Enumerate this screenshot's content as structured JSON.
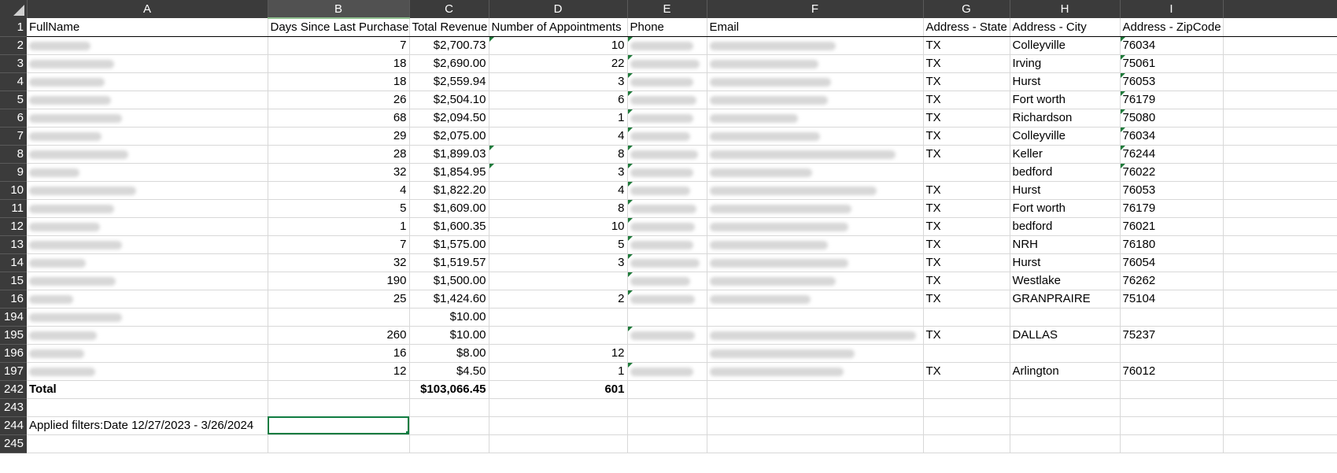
{
  "columns": [
    "A",
    "B",
    "C",
    "D",
    "E",
    "F",
    "G",
    "H",
    "I"
  ],
  "header": {
    "row": "1",
    "cells": [
      "FullName",
      "Days Since Last Purchase",
      "Total Revenue",
      "Number of Appointments",
      "Phone",
      "Email",
      "Address - State",
      "Address - City",
      "Address - ZipCode"
    ]
  },
  "rows": [
    {
      "row": "2",
      "days": "7",
      "revenue": "$2,700.73",
      "appts": "10",
      "state": "TX",
      "city": "Colleyville",
      "zip": "76034"
    },
    {
      "row": "3",
      "days": "18",
      "revenue": "$2,690.00",
      "appts": "22",
      "state": "TX",
      "city": "Irving",
      "zip": "75061"
    },
    {
      "row": "4",
      "days": "18",
      "revenue": "$2,559.94",
      "appts": "3",
      "state": "TX",
      "city": "Hurst",
      "zip": "76053"
    },
    {
      "row": "5",
      "days": "26",
      "revenue": "$2,504.10",
      "appts": "6",
      "state": "TX",
      "city": "Fort worth",
      "zip": "76179"
    },
    {
      "row": "6",
      "days": "68",
      "revenue": "$2,094.50",
      "appts": "1",
      "state": "TX",
      "city": "Richardson",
      "zip": "75080"
    },
    {
      "row": "7",
      "days": "29",
      "revenue": "$2,075.00",
      "appts": "4",
      "state": "TX",
      "city": "Colleyville",
      "zip": "76034"
    },
    {
      "row": "8",
      "days": "28",
      "revenue": "$1,899.03",
      "appts": "8",
      "state": "TX",
      "city": "Keller",
      "zip": "76244"
    },
    {
      "row": "9",
      "days": "32",
      "revenue": "$1,854.95",
      "appts": "3",
      "state": "",
      "city": "bedford",
      "zip": "76022"
    },
    {
      "row": "10",
      "days": "4",
      "revenue": "$1,822.20",
      "appts": "4",
      "state": "TX",
      "city": "Hurst",
      "zip": "76053"
    },
    {
      "row": "11",
      "days": "5",
      "revenue": "$1,609.00",
      "appts": "8",
      "state": "TX",
      "city": "Fort worth",
      "zip": "76179"
    },
    {
      "row": "12",
      "days": "1",
      "revenue": "$1,600.35",
      "appts": "10",
      "state": "TX",
      "city": "bedford",
      "zip": "76021"
    },
    {
      "row": "13",
      "days": "7",
      "revenue": "$1,575.00",
      "appts": "5",
      "state": "TX",
      "city": "NRH",
      "zip": "76180"
    },
    {
      "row": "14",
      "days": "32",
      "revenue": "$1,519.57",
      "appts": "3",
      "state": "TX",
      "city": "Hurst",
      "zip": "76054"
    },
    {
      "row": "15",
      "days": "190",
      "revenue": "$1,500.00",
      "appts": "",
      "state": "TX",
      "city": "Westlake",
      "zip": "76262"
    },
    {
      "row": "16",
      "days": "25",
      "revenue": "$1,424.60",
      "appts": "2",
      "state": "TX",
      "city": "GRANPRAIRE",
      "zip": "75104"
    },
    {
      "row": "194",
      "days": "",
      "revenue": "$10.00",
      "appts": "",
      "state": "",
      "city": "",
      "zip": ""
    },
    {
      "row": "195",
      "days": "260",
      "revenue": "$10.00",
      "appts": "",
      "state": "TX",
      "city": "DALLAS",
      "zip": "75237"
    },
    {
      "row": "196",
      "days": "16",
      "revenue": "$8.00",
      "appts": "12",
      "state": "",
      "city": "",
      "zip": ""
    },
    {
      "row": "197",
      "days": "12",
      "revenue": "$4.50",
      "appts": "1",
      "state": "TX",
      "city": "Arlington",
      "zip": "76012"
    }
  ],
  "total": {
    "row": "242",
    "label": "Total",
    "revenue": "$103,066.45",
    "appts": "601"
  },
  "blank_rows": [
    "243",
    "245"
  ],
  "filter_note": {
    "row": "244",
    "text": "Applied filters:Date 12/27/2023 - 3/26/2024"
  },
  "active_cell": "B244",
  "colors": {
    "header_bg": "#3b3b3b",
    "selection": "#107c41",
    "gridline": "#d8d8d8"
  }
}
